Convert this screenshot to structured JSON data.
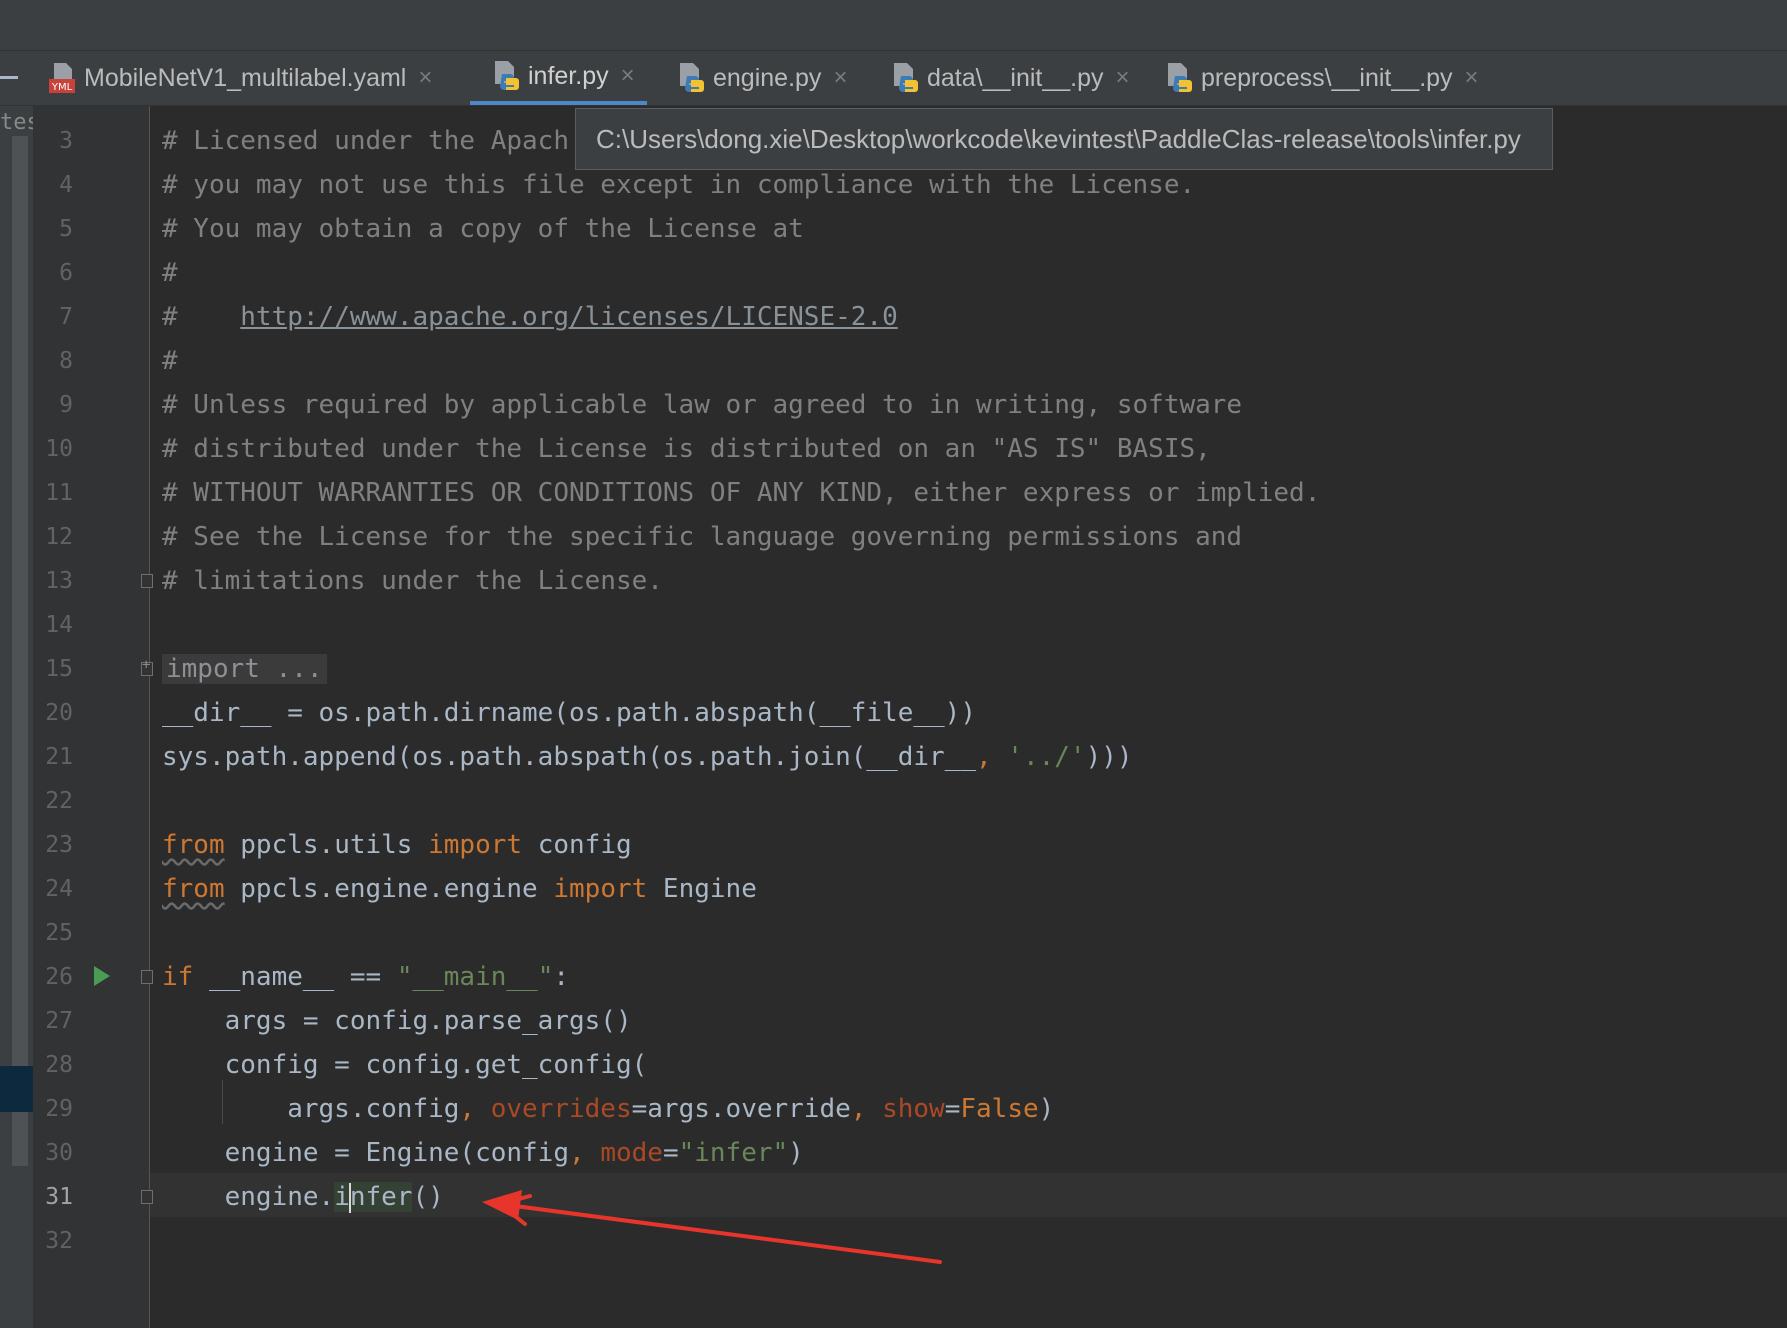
{
  "tabs": [
    {
      "label": "MobileNetV1_multilabel.yaml",
      "icon": "yaml-file-icon",
      "active": false
    },
    {
      "label": "infer.py",
      "icon": "python-file-icon",
      "active": true
    },
    {
      "label": "engine.py",
      "icon": "python-file-icon",
      "active": false
    },
    {
      "label": "data\\__init__.py",
      "icon": "python-file-icon",
      "active": false
    },
    {
      "label": "preprocess\\__init__.py",
      "icon": "python-file-icon",
      "active": false
    }
  ],
  "yaml_badge": "YML",
  "close_glyph": "×",
  "tooltip": "C:\\Users\\dong.xie\\Desktop\\workcode\\kevintest\\PaddleClas-release\\tools\\infer.py",
  "side_panel_text": "tes",
  "line_numbers": [
    "3",
    "4",
    "5",
    "6",
    "7",
    "8",
    "9",
    "10",
    "11",
    "12",
    "13",
    "14",
    "15",
    "20",
    "21",
    "22",
    "23",
    "24",
    "25",
    "26",
    "27",
    "28",
    "29",
    "30",
    "31",
    "32"
  ],
  "current_line": "31",
  "code": {
    "l3": "# Licensed under the Apach",
    "l4": "# you may not use this file except in compliance with the License.",
    "l5": "# You may obtain a copy of the License at",
    "l6": "#",
    "l7_prefix": "#    ",
    "l7_link": "http://www.apache.org/licenses/LICENSE-2.0",
    "l8": "#",
    "l9": "# Unless required by applicable law or agreed to in writing, software",
    "l10": "# distributed under the License is distributed on an \"AS IS\" BASIS,",
    "l11": "# WITHOUT WARRANTIES OR CONDITIONS OF ANY KIND, either express or implied.",
    "l12": "# See the License for the specific language governing permissions and",
    "l13": "# limitations under the License.",
    "l15": "import ...",
    "l20": "__dir__ = os.path.dirname(os.path.abspath(__file__))",
    "l21_a": "sys.path.append(os.path.abspath(os.path.join(__dir__",
    "l21_comma": ",",
    "l21_str": " '../'",
    "l21_b": ")))",
    "l23_from": "from",
    "l23_mod": " ppcls.utils ",
    "l23_import": "import",
    "l23_name": " config",
    "l24_from": "from",
    "l24_mod": " ppcls.engine.engine ",
    "l24_import": "import",
    "l24_name": " Engine",
    "l26_if": "if",
    "l26_a": " __name__ == ",
    "l26_str": "\"__main__\"",
    "l26_b": ":",
    "l27": "    args = config.parse_args()",
    "l28": "    config = config.get_config(",
    "l29_a": "        args.config",
    "l29_c1": ", ",
    "l29_p1": "overrides",
    "l29_b": "=args.override",
    "l29_c2": ", ",
    "l29_p2": "show",
    "l29_eq": "=",
    "l29_false": "False",
    "l29_end": ")",
    "l30_a": "    engine = Engine(config",
    "l30_c": ", ",
    "l30_p": "mode",
    "l30_eq": "=",
    "l30_str": "\"infer\"",
    "l30_end": ")",
    "l31_a": "    engine.",
    "l31_i": "i",
    "l31_nfer": "nfer",
    "l31_b": "()"
  },
  "colors": {
    "comment": "#808080",
    "keyword": "#cc7832",
    "string": "#6a8759",
    "param": "#aa4926",
    "annotation_arrow": "#e8352c"
  }
}
